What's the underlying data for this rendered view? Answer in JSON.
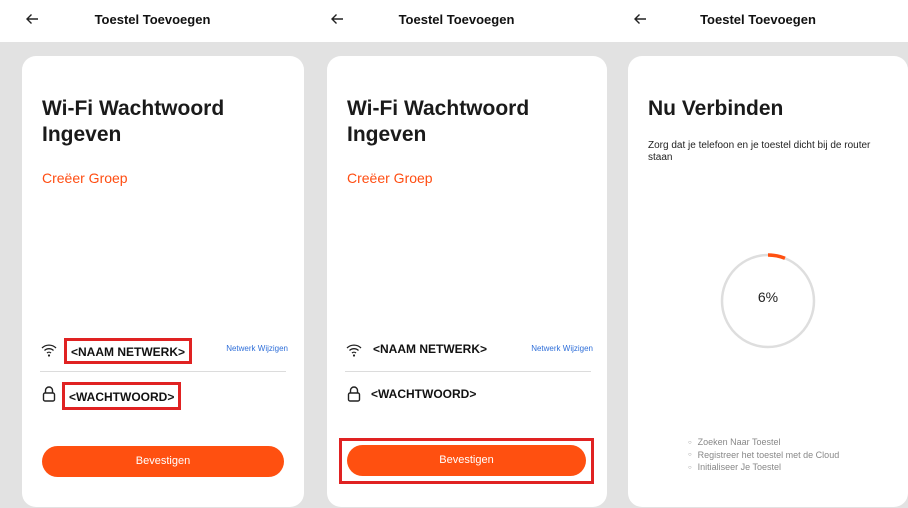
{
  "screens": [
    {
      "title": "Toestel Toevoegen",
      "heading": "Wi-Fi Wachtwoord Ingeven",
      "group_link": "Creëer Groep",
      "network_name": "<NAAM NETWERK>",
      "change_network": "Netwerk Wijzigen",
      "password": "<WACHTWOORD>",
      "confirm": "Bevestigen"
    },
    {
      "title": "Toestel Toevoegen",
      "heading": "Wi-Fi Wachtwoord Ingeven",
      "group_link": "Creëer Groep",
      "network_name": "<NAAM NETWERK>",
      "change_network": "Netwerk Wijzigen",
      "password": "<WACHTWOORD>",
      "confirm": "Bevestigen"
    },
    {
      "title": "Toestel Toevoegen",
      "heading": "Nu Verbinden",
      "subtext": "Zorg dat je telefoon en je toestel dicht bij de router staan",
      "progress_label": "6%",
      "progress_fraction": 0.06,
      "steps": [
        "Zoeken Naar Toestel",
        "Registreer het toestel met de Cloud",
        "Initialiseer Je Toestel"
      ]
    }
  ],
  "colors": {
    "accent": "#ff5010",
    "highlight_box": "#e02222",
    "link": "#2f6fd9",
    "background": "#e2e2e2"
  },
  "icons": [
    "back-arrow-icon",
    "wifi-icon",
    "lock-icon"
  ]
}
